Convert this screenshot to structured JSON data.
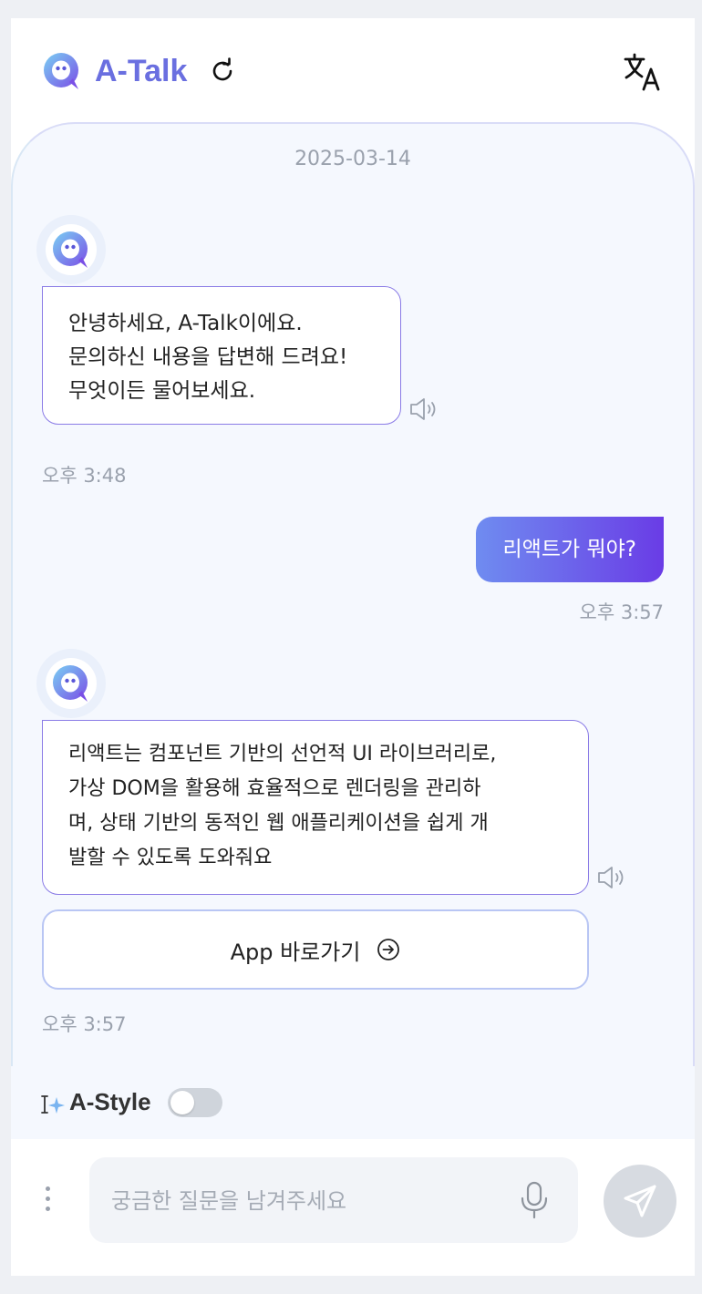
{
  "header": {
    "brand": "A-Talk",
    "logo_icon": "atalk-logo-icon",
    "refresh_icon": "refresh-icon",
    "translate_icon": "translate-icon",
    "brand_color": "#6a6fe0"
  },
  "chat": {
    "date": "2025-03-14",
    "messages": [
      {
        "role": "bot",
        "text": "안녕하세요, A-Talk이에요.\n문의하신 내용을 답변해 드려요!\n무엇이든 물어보세요.",
        "time": "오후 3:48"
      },
      {
        "role": "user",
        "text": "리액트가 뭐야?",
        "time": "오후 3:57"
      },
      {
        "role": "bot",
        "text": "리액트는 컴포넌트 기반의 선언적 UI 라이브러리로,\n가상 DOM을 활용해 효율적으로 렌더링을 관리하\n며, 상태 기반의 동적인 웹 애플리케이션을 쉽게 개\n발할 수 있도록 도와줘요",
        "link_label": "App 바로가기",
        "time": "오후 3:57"
      }
    ]
  },
  "style_bar": {
    "label": "A-Style",
    "toggle_on": false
  },
  "input": {
    "placeholder": "궁금한 질문을 남겨주세요",
    "value": ""
  },
  "colors": {
    "user_bubble_start": "#6f8cf0",
    "user_bubble_end": "#6a3ce6",
    "bot_bubble_border": "#8a7be6",
    "send_button": "#d7dbe1"
  }
}
